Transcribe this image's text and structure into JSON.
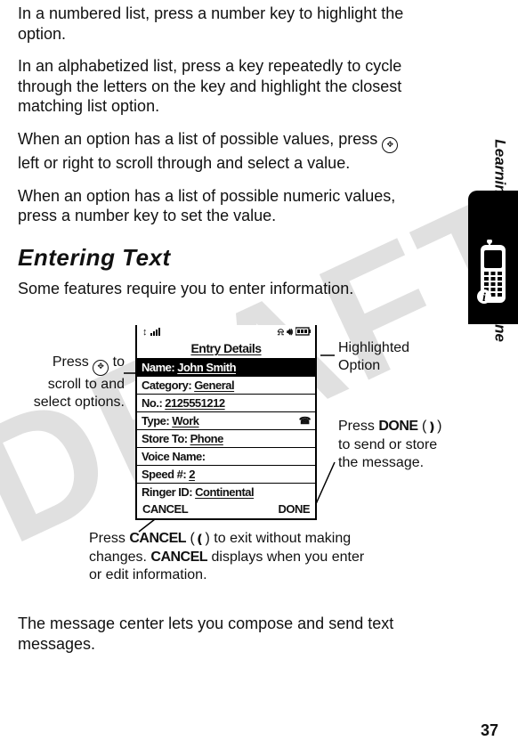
{
  "paragraphs": {
    "p1": "In a numbered list, press a number key to highlight the option.",
    "p2": "In an alphabetized list, press a key repeatedly to cycle through the letters on the key and highlight the closest matching list option.",
    "p3_a": "When an option has a list of possible values, press ",
    "p3_b": " left or right to scroll through and select a value.",
    "p4": "When an option has a list of possible numeric values, press a number key to set the value.",
    "heading": "Entering Text",
    "p5": "Some features require you to enter information.",
    "p6": "The message center lets you compose and send text messages."
  },
  "side_tab": {
    "text": "Learning to Use Your Phone"
  },
  "watermark": "DRAFT",
  "diagram": {
    "callout_left_a": "Press ",
    "callout_left_b": " to scroll to and select options.",
    "callout_highlight": "Highlighted Option",
    "callout_done_a": "Press ",
    "callout_done_b": "DONE",
    "callout_done_c": " (",
    "callout_done_d": ") to send or store the message.",
    "callout_cancel_a": "Press ",
    "callout_cancel_b": "CANCEL",
    "callout_cancel_c": " (",
    "callout_cancel_d": ") to exit without making changes. ",
    "callout_cancel_e": "CANCEL",
    "callout_cancel_f": " displays when you enter or edit information."
  },
  "screen": {
    "title": "Entry Details",
    "rows": [
      {
        "label": "Name:",
        "value": "John Smith",
        "highlighted": true
      },
      {
        "label": "Category:",
        "value": "General"
      },
      {
        "label": "No.:",
        "value": "2125551212"
      },
      {
        "label": "Type:",
        "value": "Work",
        "trailing_icon": "dial-icon"
      },
      {
        "label": "Store To:",
        "value": "Phone"
      },
      {
        "label": "Voice Name:",
        "value": ""
      },
      {
        "label": "Speed #:",
        "value": "2"
      },
      {
        "label": "Ringer ID:",
        "value": "Continental"
      }
    ],
    "left_softkey": "CANCEL",
    "right_softkey": "DONE"
  },
  "page_number": "37"
}
